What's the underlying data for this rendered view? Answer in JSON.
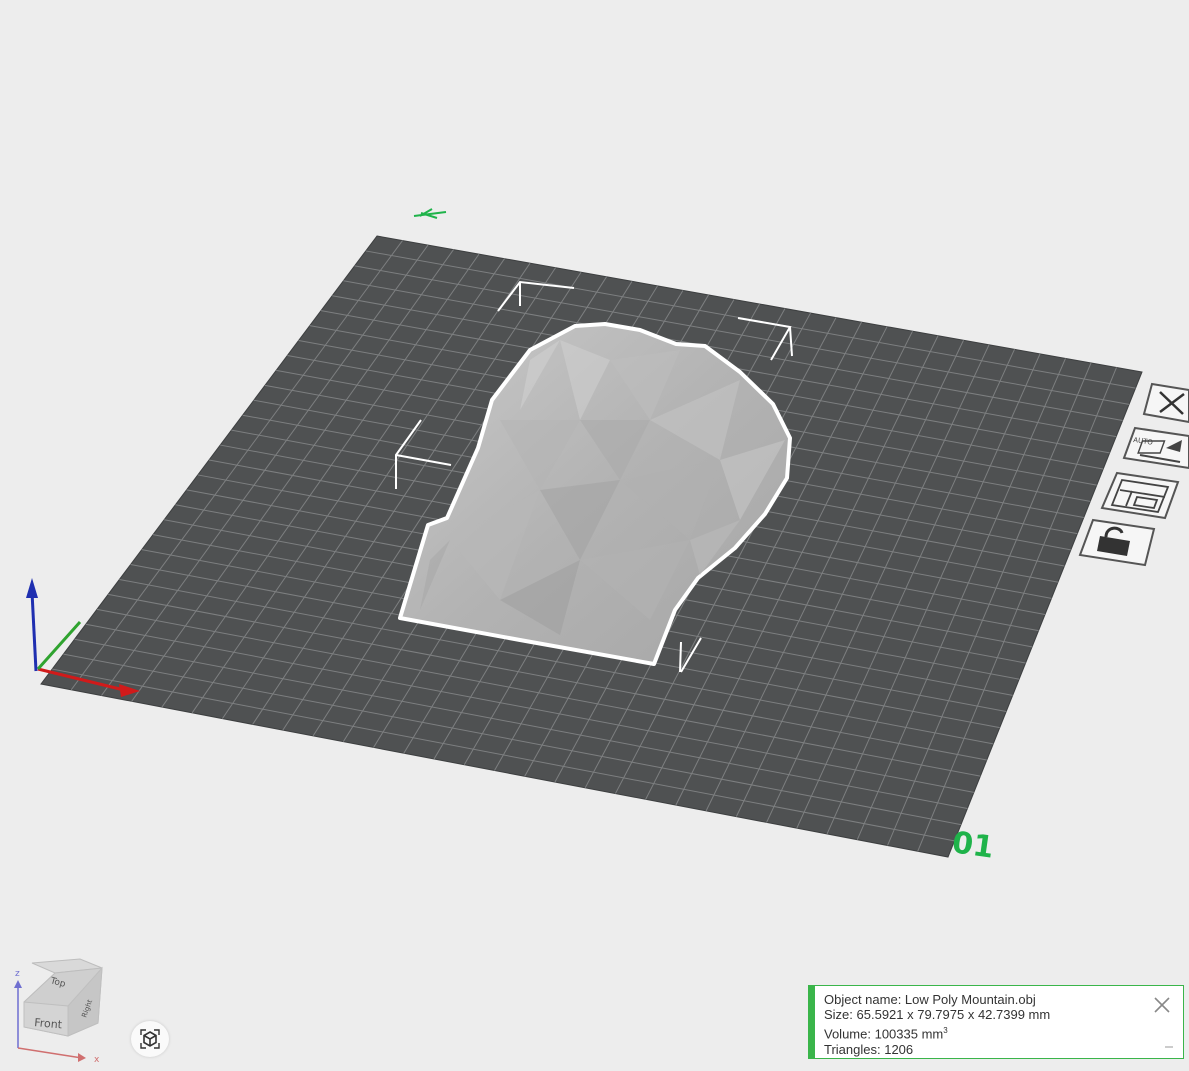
{
  "viewport": {
    "plate_label": "01",
    "view_cube": {
      "top_face": "Top",
      "front_face": "Front",
      "right_face": "Right",
      "axis_z": "z",
      "axis_x": "x"
    }
  },
  "toolbar_icons": [
    "delete-icon",
    "auto-arrange-icon",
    "layout-icon",
    "lock-icon"
  ],
  "info_panel": {
    "object_name": "Object name: Low Poly Mountain.obj",
    "size": "Size: 65.5921 x 79.7975 x 42.7399 mm",
    "volume": "Volume: 100335 mm",
    "volume_unit_sup": "3",
    "triangles": "Triangles: 1206"
  },
  "colors": {
    "background": "#ededed",
    "plate": "#4f5152",
    "grid_line": "#7a7c7d",
    "accent_green": "#3ab54a",
    "axis_x": "#d11a1a",
    "axis_y": "#2fa32f",
    "axis_z": "#1f2fb0",
    "model": "#b9b9b9"
  }
}
